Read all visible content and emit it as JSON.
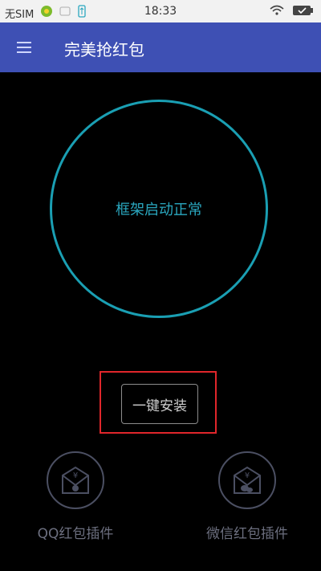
{
  "status_bar": {
    "carrier": "无SIM",
    "time": "18:33",
    "icons": [
      "sim-status-icon",
      "notification-icon",
      "usb-icon",
      "wifi-icon",
      "battery-icon"
    ]
  },
  "toolbar": {
    "menu_icon": "hamburger-menu-icon",
    "title": "完美抢红包"
  },
  "status_circle": {
    "text": "框架启动正常",
    "ring_color": "#1a9fb3"
  },
  "install_button": {
    "label": "一键安装"
  },
  "plugins": [
    {
      "label": "QQ红包插件",
      "icon": "qq-envelope-icon"
    },
    {
      "label": "微信红包插件",
      "icon": "wechat-envelope-icon"
    }
  ],
  "colors": {
    "toolbar": "#3e50b4",
    "highlight": "#e0262b",
    "background": "#000000"
  }
}
